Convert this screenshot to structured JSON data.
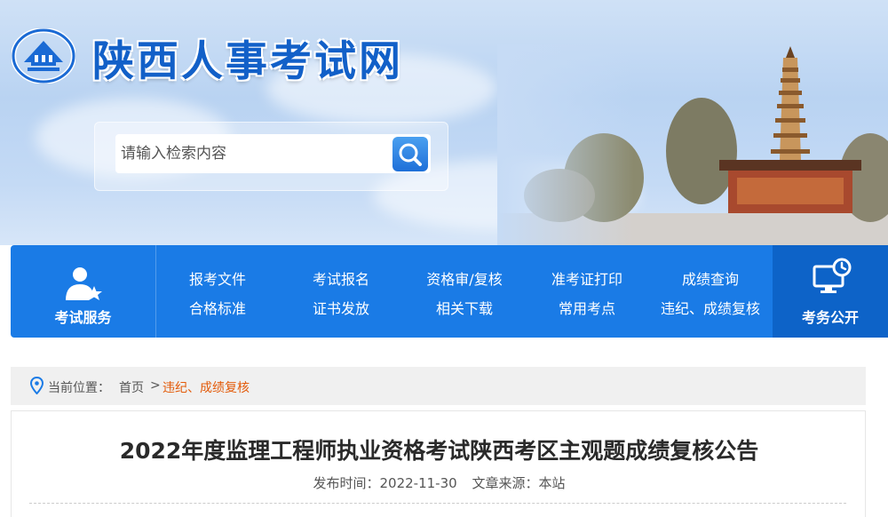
{
  "site": {
    "title": "陕西人事考试网"
  },
  "search": {
    "placeholder": "请输入检索内容"
  },
  "nav": {
    "left_label": "考试服务",
    "right_label": "考务公开",
    "row1": [
      "报考文件",
      "考试报名",
      "资格审/复核",
      "准考证打印",
      "成绩查询"
    ],
    "row2": [
      "合格标准",
      "证书发放",
      "相关下载",
      "常用考点",
      "违纪、成绩复核"
    ]
  },
  "breadcrumb": {
    "prefix": "当前位置：",
    "home": "首页",
    "separator": ">",
    "current": "违纪、成绩复核"
  },
  "article": {
    "title": "2022年度监理工程师执业资格考试陕西考区主观题成绩复核公告",
    "publish_label": "发布时间：",
    "publish_date": "2022-11-30",
    "source_label": "文章来源：",
    "source": "本站"
  },
  "colors": {
    "brand_blue": "#1a7be6",
    "nav_dark": "#0d63c8",
    "breadcrumb_current": "#e35b0a"
  }
}
